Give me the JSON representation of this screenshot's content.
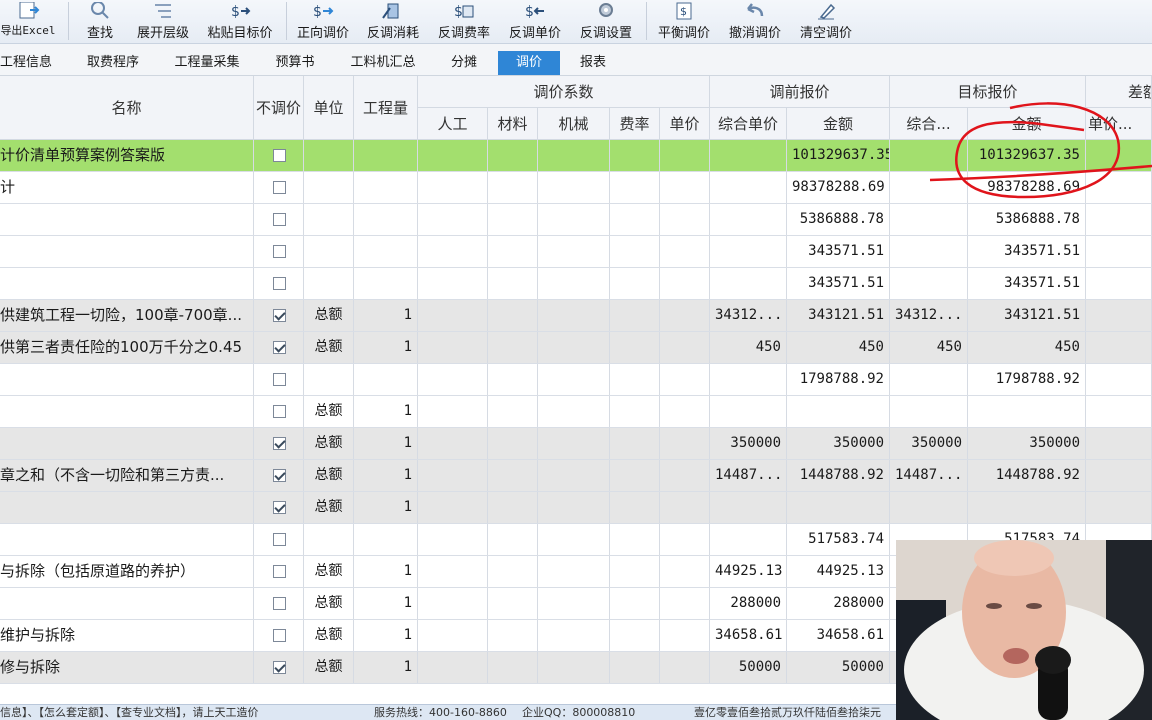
{
  "toolbar": {
    "buttons": [
      {
        "label": "导出Excel",
        "icon": "export-excel-icon"
      },
      {
        "label": "查找",
        "icon": "search-icon"
      },
      {
        "label": "展开层级",
        "icon": "expand-levels-icon"
      },
      {
        "label": "粘贴目标价",
        "icon": "paste-target-price-icon"
      },
      {
        "label": "正向调价",
        "icon": "forward-adjust-icon"
      },
      {
        "label": "反调消耗",
        "icon": "reverse-consumption-icon"
      },
      {
        "label": "反调费率",
        "icon": "reverse-rate-icon"
      },
      {
        "label": "反调单价",
        "icon": "reverse-unit-price-icon"
      },
      {
        "label": "反调设置",
        "icon": "reverse-settings-icon"
      },
      {
        "label": "平衡调价",
        "icon": "balance-adjust-icon"
      },
      {
        "label": "撤消调价",
        "icon": "undo-adjust-icon"
      },
      {
        "label": "清空调价",
        "icon": "clear-adjust-icon"
      }
    ]
  },
  "tabs": [
    {
      "label": "工程信息",
      "active": false
    },
    {
      "label": "取费程序",
      "active": false
    },
    {
      "label": "工程量采集",
      "active": false
    },
    {
      "label": "预算书",
      "active": false
    },
    {
      "label": "工料机汇总",
      "active": false
    },
    {
      "label": "分摊",
      "active": false
    },
    {
      "label": "调价",
      "active": true
    },
    {
      "label": "报表",
      "active": false
    }
  ],
  "grid": {
    "headers": {
      "name": "名称",
      "no_adjust": "不调价",
      "unit": "单位",
      "quantity": "工程量",
      "coef_group": "调价系数",
      "coef_labor": "人工",
      "coef_material": "材料",
      "coef_machine": "机械",
      "coef_rate": "费率",
      "coef_unit_price": "单价",
      "pre_group": "调前报价",
      "pre_unit_price": "综合单价",
      "pre_amount": "金额",
      "target_group": "目标报价",
      "target_unit_price": "综合...",
      "target_amount": "金额",
      "diff_group": "差额",
      "diff_unit_price": "单价..."
    },
    "rows": [
      {
        "style": "green",
        "name": "计价清单预算案例答案版",
        "checked": false,
        "unit": "",
        "qty": "",
        "pre_unit": "",
        "pre_amount": "101329637.35",
        "target_unit": "",
        "target_amount": "101329637.35"
      },
      {
        "style": "white",
        "name": "计",
        "checked": false,
        "unit": "",
        "qty": "",
        "pre_unit": "",
        "pre_amount": "98378288.69",
        "target_unit": "",
        "target_amount": "98378288.69"
      },
      {
        "style": "white",
        "name": "",
        "checked": false,
        "unit": "",
        "qty": "",
        "pre_unit": "",
        "pre_amount": "5386888.78",
        "target_unit": "",
        "target_amount": "5386888.78"
      },
      {
        "style": "white",
        "name": "",
        "checked": false,
        "unit": "",
        "qty": "",
        "pre_unit": "",
        "pre_amount": "343571.51",
        "target_unit": "",
        "target_amount": "343571.51"
      },
      {
        "style": "white",
        "name": "",
        "checked": false,
        "unit": "",
        "qty": "",
        "pre_unit": "",
        "pre_amount": "343571.51",
        "target_unit": "",
        "target_amount": "343571.51"
      },
      {
        "style": "gray",
        "name": "供建筑工程一切险，100章-700章...",
        "checked": true,
        "unit": "总额",
        "qty": "1",
        "pre_unit": "34312...",
        "pre_amount": "343121.51",
        "target_unit": "34312...",
        "target_amount": "343121.51"
      },
      {
        "style": "gray",
        "name": "供第三者责任险的100万千分之0.45",
        "checked": true,
        "unit": "总额",
        "qty": "1",
        "pre_unit": "450",
        "pre_amount": "450",
        "target_unit": "450",
        "target_amount": "450"
      },
      {
        "style": "white",
        "name": "",
        "checked": false,
        "unit": "",
        "qty": "",
        "pre_unit": "",
        "pre_amount": "1798788.92",
        "target_unit": "",
        "target_amount": "1798788.92"
      },
      {
        "style": "white",
        "name": "",
        "checked": false,
        "unit": "总额",
        "qty": "1",
        "pre_unit": "",
        "pre_amount": "",
        "target_unit": "",
        "target_amount": ""
      },
      {
        "style": "gray",
        "name": "",
        "checked": true,
        "unit": "总额",
        "qty": "1",
        "pre_unit": "350000",
        "pre_amount": "350000",
        "target_unit": "350000",
        "target_amount": "350000"
      },
      {
        "style": "gray",
        "name": "章之和（不含一切险和第三方责...",
        "checked": true,
        "unit": "总额",
        "qty": "1",
        "pre_unit": "14487...",
        "pre_amount": "1448788.92",
        "target_unit": "14487...",
        "target_amount": "1448788.92"
      },
      {
        "style": "gray",
        "name": "",
        "checked": true,
        "unit": "总额",
        "qty": "1",
        "pre_unit": "",
        "pre_amount": "",
        "target_unit": "",
        "target_amount": ""
      },
      {
        "style": "white",
        "name": "",
        "checked": false,
        "unit": "",
        "qty": "",
        "pre_unit": "",
        "pre_amount": "517583.74",
        "target_unit": "",
        "target_amount": "517583.74"
      },
      {
        "style": "white",
        "name": "与拆除（包括原道路的养护）",
        "checked": false,
        "unit": "总额",
        "qty": "1",
        "pre_unit": "44925.13",
        "pre_amount": "44925.13",
        "target_unit": "",
        "target_amount": ""
      },
      {
        "style": "white",
        "name": "",
        "checked": false,
        "unit": "总额",
        "qty": "1",
        "pre_unit": "288000",
        "pre_amount": "288000",
        "target_unit": "",
        "target_amount": ""
      },
      {
        "style": "white",
        "name": "维护与拆除",
        "checked": false,
        "unit": "总额",
        "qty": "1",
        "pre_unit": "34658.61",
        "pre_amount": "34658.61",
        "target_unit": "",
        "target_amount": ""
      },
      {
        "style": "gray",
        "name": "修与拆除",
        "checked": true,
        "unit": "总额",
        "qty": "1",
        "pre_unit": "50000",
        "pre_amount": "50000",
        "target_unit": "",
        "target_amount": ""
      }
    ]
  },
  "status": {
    "help": "信息】、【怎么套定额】、【查专业文档】，请上天工造价",
    "hotline": "服务热线：400-160-8860",
    "qq": "企业QQ：800008810",
    "total_words": "壹亿零壹佰叁拾贰万玖仟陆佰叁拾柒元"
  },
  "colors": {
    "annotation": "#e0141b",
    "active_tab": "#2f86d6",
    "highlight_row": "#a3df6e"
  }
}
